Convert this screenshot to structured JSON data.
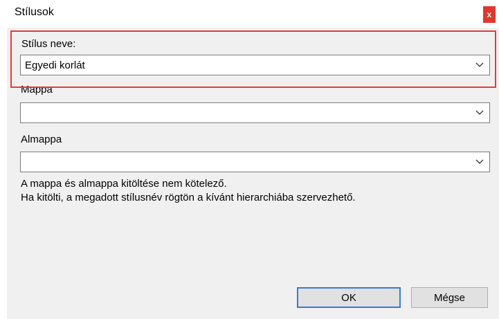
{
  "window": {
    "title": "Stílusok",
    "close_label": "x"
  },
  "fields": {
    "style_name": {
      "label": "Stílus neve:",
      "value": "Egyedi korlát"
    },
    "folder": {
      "label": "Mappa",
      "value": ""
    },
    "subfolder": {
      "label": "Almappa",
      "value": ""
    }
  },
  "info": {
    "line1": "A mappa és almappa kitöltése nem kötelező.",
    "line2": "Ha kitölti, a megadott stílusnév rögtön a kívánt hierarchiába szervezhető."
  },
  "buttons": {
    "ok": "OK",
    "cancel": "Mégse"
  },
  "colors": {
    "highlight": "#e33a3a",
    "close_bg": "#e0372f",
    "default_button_border": "#3a78d6"
  }
}
